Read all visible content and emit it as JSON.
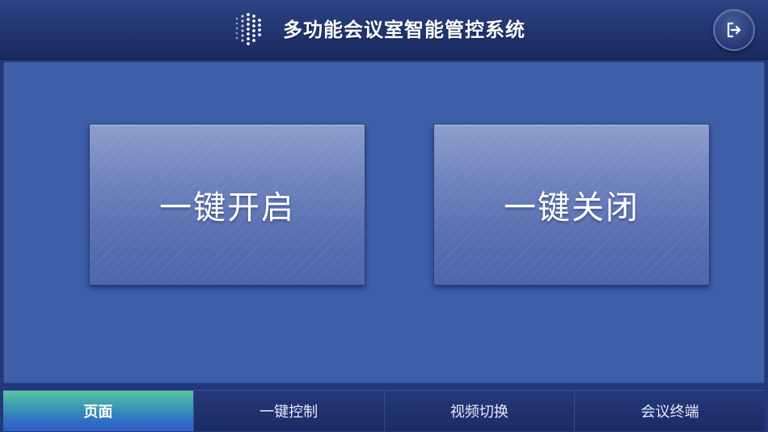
{
  "header": {
    "title": "多功能会议室智能管控系统",
    "logo_icon": "dot-matrix-logo-icon",
    "exit_icon": "logout-icon"
  },
  "main": {
    "buttons": [
      {
        "label": "一键开启"
      },
      {
        "label": "一键关闭"
      }
    ]
  },
  "nav": {
    "active_index": 0,
    "tabs": [
      {
        "label": "页面"
      },
      {
        "label": "一键控制"
      },
      {
        "label": "视频切换"
      },
      {
        "label": "会议终端"
      }
    ]
  },
  "colors": {
    "accent_active": "#3c9fb2",
    "panel": "#3f5ea8",
    "header": "#203470"
  }
}
